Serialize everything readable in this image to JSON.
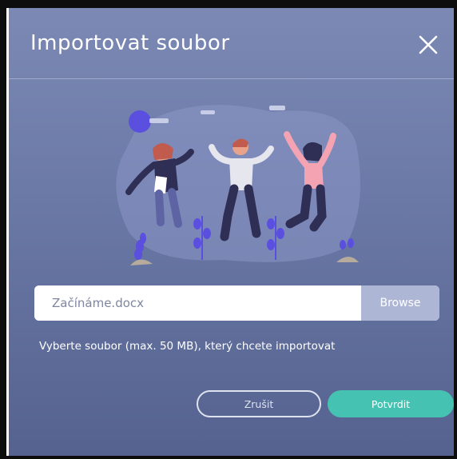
{
  "dialog": {
    "title": "Importovat soubor",
    "close_icon": "close-icon"
  },
  "file": {
    "value": "Začínáme.docx",
    "browse_label": "Browse"
  },
  "hint": "Vyberte soubor (max. 50 MB), který chcete importovat",
  "actions": {
    "cancel_label": "Zrušit",
    "confirm_label": "Potvrdit"
  },
  "colors": {
    "dialog_top": "#7c89b4",
    "dialog_bottom": "#55628f",
    "browse_button": "#aeb6d6",
    "confirm_button": "#45c2b1"
  }
}
